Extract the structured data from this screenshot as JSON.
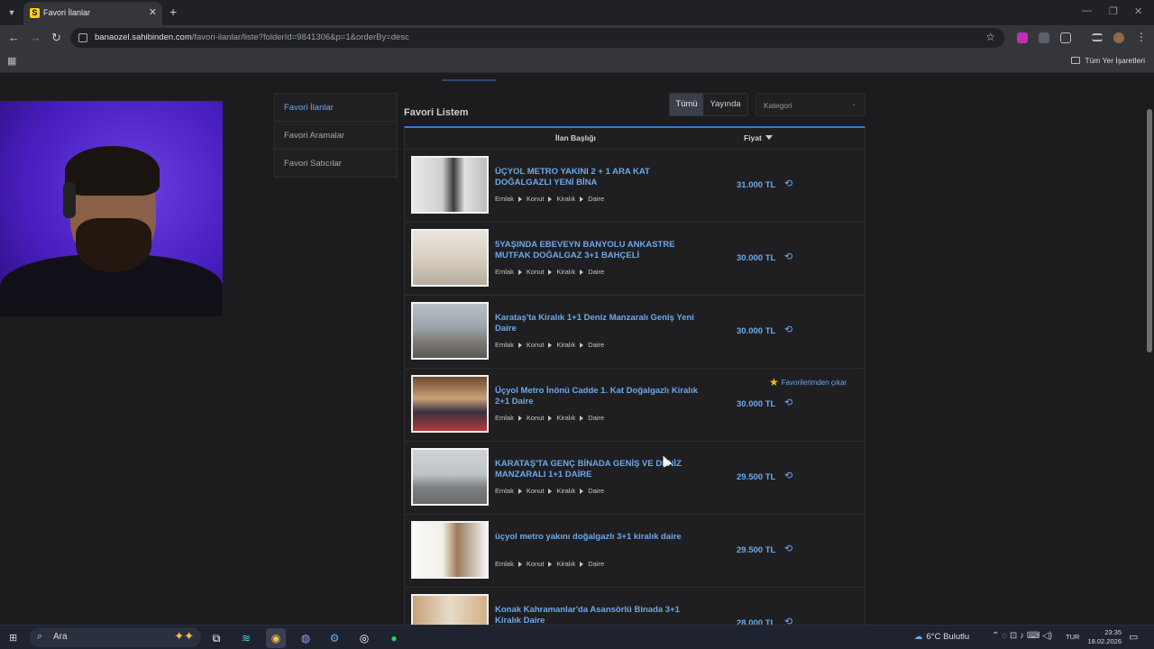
{
  "browser": {
    "tab_title": "Favori İlanlar",
    "favicon_letter": "S",
    "url_host": "banaozel.sahibinden.com",
    "url_path": "/favori-ilanlar/liste?folderId=9841306&p=1&orderBy=desc",
    "bookmarks_all": "Tüm Yer İşaretleri"
  },
  "sidebar": {
    "items": [
      {
        "label": "Favori İlanlar",
        "active": true
      },
      {
        "label": "Favori Aramalar",
        "active": false
      },
      {
        "label": "Favori Satıcılar",
        "active": false
      }
    ]
  },
  "main": {
    "title": "Favori Listem",
    "filter_all": "Tümü",
    "filter_live": "Yayında",
    "category_placeholder": "Kategori",
    "col_title": "İlan Başlığı",
    "col_price": "Fiyat",
    "remove_favorite": "Favorilerimden çıkar"
  },
  "breadcrumb": [
    "Emlak",
    "Konut",
    "Kiralık",
    "Daire"
  ],
  "listings": [
    {
      "title": "ÜÇYOL METRO YAKINI 2 + 1 ARA KAT DOĞALGAZLI YENİ BİNA",
      "price": "31.000 TL"
    },
    {
      "title": "5YAŞINDA EBEVEYN BANYOLU ANKASTRE MUTFAK DOĞALGAZ 3+1 BAHÇELİ",
      "price": "30.000 TL"
    },
    {
      "title": "Karataş'ta Kiralık 1+1 Deniz Manzaralı Geniş Yeni Daire",
      "price": "30.000 TL"
    },
    {
      "title": "Üçyol Metro İnönü Cadde 1. Kat Doğalgazlı Kiralık 2+1 Daire",
      "price": "30.000 TL"
    },
    {
      "title": "KARATAŞ'TA GENÇ BİNADA GENİŞ VE DENİZ MANZARALI 1+1 DAİRE",
      "price": "29.500 TL"
    },
    {
      "title": "üçyol metro yakını doğalgazlı 3+1 kiralık daire",
      "price": "29.500 TL"
    },
    {
      "title": "Konak Kahramanlar'da Asansörlü Binada 3+1 Kiralık Daire",
      "price": "28.000 TL"
    }
  ],
  "taskbar": {
    "search_placeholder": "Ara",
    "weather": "6°C  Bulutlu",
    "lang": "TUR",
    "time": "23:35",
    "date": "18.02.2026"
  },
  "colors": {
    "accent": "#6ea8ea",
    "background": "#1c1c1e"
  }
}
